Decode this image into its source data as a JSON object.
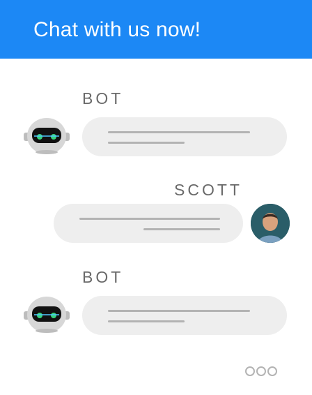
{
  "header": {
    "title": "Chat with us now!"
  },
  "messages": [
    {
      "sender": "BOT",
      "avatar": "robot-icon"
    },
    {
      "sender": "SCOTT",
      "avatar": "user-avatar"
    },
    {
      "sender": "BOT",
      "avatar": "robot-icon"
    }
  ],
  "typing_indicator": {
    "icon": "typing-dots-icon"
  },
  "colors": {
    "header": "#1c88f5",
    "bubble": "#eeeeee",
    "line": "#b3b3b3",
    "label": "#6a6a6a"
  }
}
